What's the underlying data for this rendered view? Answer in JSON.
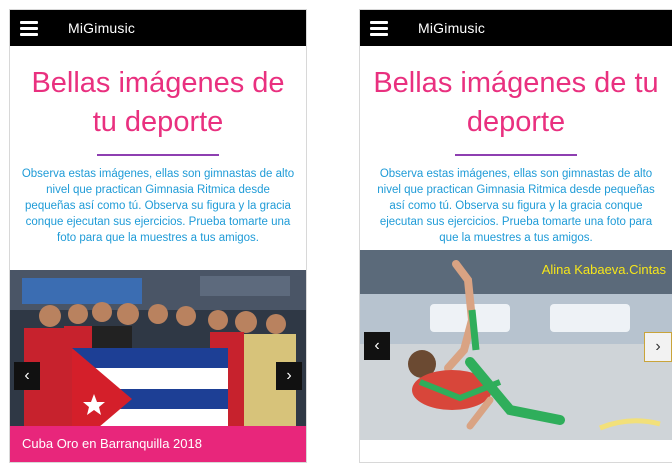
{
  "app": {
    "title": "MiGimusic"
  },
  "page": {
    "heading": "Bellas imágenes de tu deporte",
    "intro": "Observa estas imágenes, ellas son gimnastas de alto nivel que practican Gimnasia Ritmica desde pequeñas así como tú. Observa su figura y la gracia conque ejecutan sus ejercicios. Prueba tomarte una foto para que la muestres a tus amigos."
  },
  "carousel": {
    "prev_glyph": "‹",
    "next_glyph": "›",
    "slides": [
      {
        "caption": "Cuba Oro en Barranquilla 2018"
      },
      {
        "caption": "Alina Kabaeva.Cintas"
      }
    ]
  },
  "colors": {
    "appbar": "#000000",
    "heading": "#e9307f",
    "divider": "#8e3fb1",
    "intro_text": "#1f9bd7",
    "caption_bar": "#e8267b",
    "caption_highlight": "#f6e61a"
  },
  "icons": {
    "menu": "hamburger-menu-icon",
    "prev": "chevron-left-icon",
    "next": "chevron-right-icon"
  }
}
